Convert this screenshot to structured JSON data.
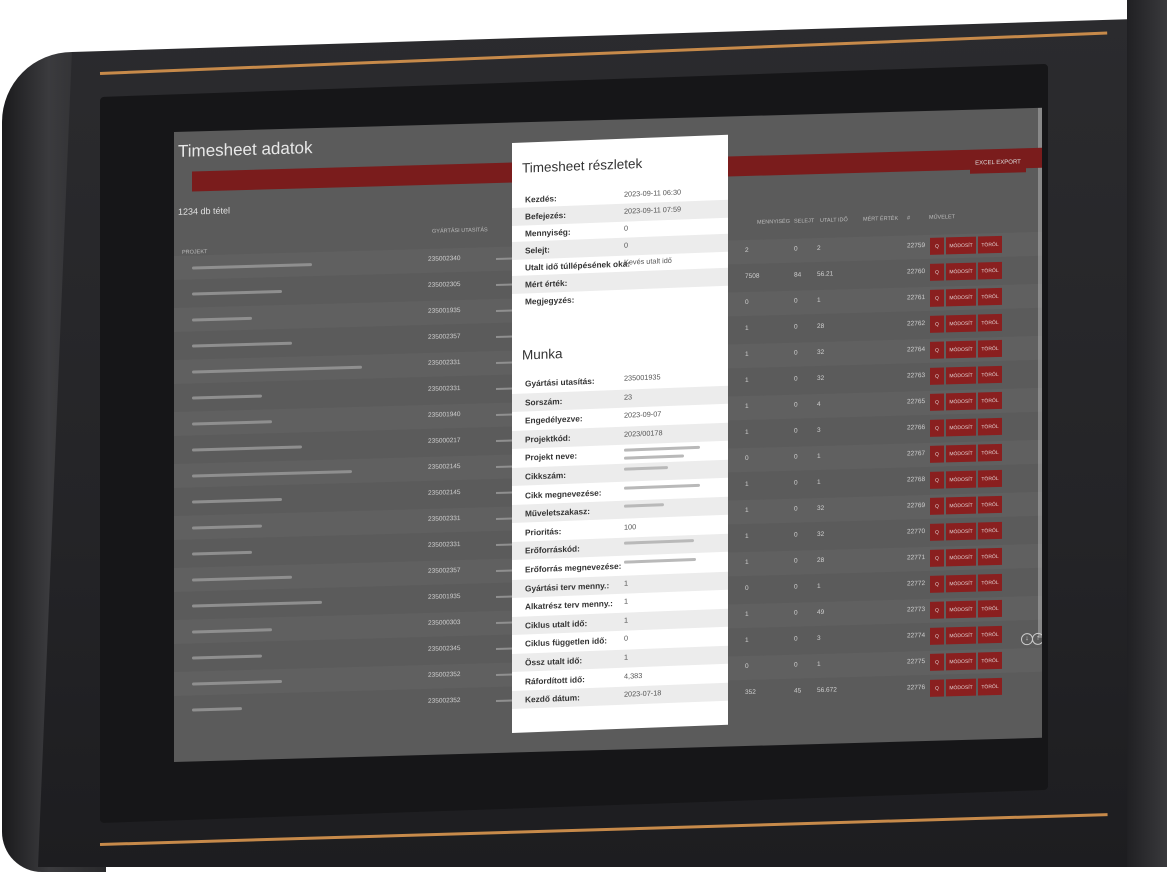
{
  "app": {
    "title": "Timesheet adatok",
    "count": "1234 db tétel",
    "export_label": "EXCEL EXPORT"
  },
  "table": {
    "headers": [
      "PROJEKT",
      "GYÁRTÁSI UTASÍTÁS",
      "MENNYISÉG",
      "SELEJT",
      "UTALT IDŐ",
      "MÉRT ÉRTÉK",
      "#",
      "MŰVELET"
    ],
    "rows": [
      {
        "order": "235002340",
        "qty": "2",
        "scrap": "0",
        "time": "2",
        "id": "22759"
      },
      {
        "order": "235002305",
        "qty": "7508",
        "scrap": "84",
        "time": "56.21",
        "id": "22760"
      },
      {
        "order": "235001935",
        "qty": "0",
        "scrap": "0",
        "time": "1",
        "id": "22761"
      },
      {
        "order": "235002357",
        "qty": "1",
        "scrap": "0",
        "time": "28",
        "id": "22762"
      },
      {
        "order": "235002331",
        "qty": "1",
        "scrap": "0",
        "time": "32",
        "id": "22764"
      },
      {
        "order": "235002331",
        "qty": "1",
        "scrap": "0",
        "time": "32",
        "id": "22763"
      },
      {
        "order": "235001940",
        "qty": "1",
        "scrap": "0",
        "time": "4",
        "id": "22765"
      },
      {
        "order": "235000217",
        "qty": "1",
        "scrap": "0",
        "time": "3",
        "id": "22766"
      },
      {
        "order": "235002145",
        "qty": "0",
        "scrap": "0",
        "time": "1",
        "id": "22767"
      },
      {
        "order": "235002145",
        "qty": "1",
        "scrap": "0",
        "time": "1",
        "id": "22768"
      },
      {
        "order": "235002331",
        "qty": "1",
        "scrap": "0",
        "time": "32",
        "id": "22769"
      },
      {
        "order": "235002331",
        "qty": "1",
        "scrap": "0",
        "time": "32",
        "id": "22770"
      },
      {
        "order": "235002357",
        "qty": "1",
        "scrap": "0",
        "time": "28",
        "id": "22771"
      },
      {
        "order": "235001935",
        "qty": "0",
        "scrap": "0",
        "time": "1",
        "id": "22772"
      },
      {
        "order": "235000303",
        "qty": "1",
        "scrap": "0",
        "time": "49",
        "id": "22773"
      },
      {
        "order": "235002345",
        "qty": "1",
        "scrap": "0",
        "time": "3",
        "id": "22774"
      },
      {
        "order": "235002352",
        "qty": "0",
        "scrap": "0",
        "time": "1",
        "id": "22775"
      },
      {
        "order": "235002352",
        "qty": "352",
        "scrap": "45",
        "time": "56.672",
        "id": "22776"
      }
    ],
    "view_label": "Q",
    "edit_label": "MÓDOSÍT",
    "delete_label": "TÖRÖL"
  },
  "modal": {
    "title": "Timesheet részletek",
    "details": [
      {
        "label": "Kezdés:",
        "value": "2023-09-11 06:30"
      },
      {
        "label": "Befejezés:",
        "value": "2023-09-11 07:59"
      },
      {
        "label": "Mennyiség:",
        "value": "0"
      },
      {
        "label": "Selejt:",
        "value": "0"
      },
      {
        "label": "Utalt idő túllépésének oka:",
        "value": "Kevés utalt idő"
      },
      {
        "label": "Mért érték:",
        "value": ""
      },
      {
        "label": "Megjegyzés:",
        "value": ""
      }
    ],
    "work_title": "Munka",
    "work": [
      {
        "label": "Gyártási utasítás:",
        "value": "235001935"
      },
      {
        "label": "Sorszám:",
        "value": "23"
      },
      {
        "label": "Engedélyezve:",
        "value": "2023-09-07"
      },
      {
        "label": "Projektkód:",
        "value": "2023/00178"
      },
      {
        "label": "Projekt neve:",
        "value": ""
      },
      {
        "label": "Cikkszám:",
        "value": ""
      },
      {
        "label": "Cikk megnevezése:",
        "value": ""
      },
      {
        "label": "Műveletszakasz:",
        "value": ""
      },
      {
        "label": "Prioritás:",
        "value": "100"
      },
      {
        "label": "Erőforráskód:",
        "value": ""
      },
      {
        "label": "Erőforrás megnevezése:",
        "value": ""
      },
      {
        "label": "Gyártási terv menny.:",
        "value": "1"
      },
      {
        "label": "Alkatrész terv menny.:",
        "value": "1"
      },
      {
        "label": "Ciklus utalt idő:",
        "value": "1"
      },
      {
        "label": "Ciklus független idő:",
        "value": "0"
      },
      {
        "label": "Össz utalt idő:",
        "value": "1"
      },
      {
        "label": "Ráfordított idő:",
        "value": "4,383"
      },
      {
        "label": "Kezdő dátum:",
        "value": "2023-07-18"
      }
    ]
  },
  "colors": {
    "accent": "#c78a4a",
    "brand_red": "#8a1f1f",
    "overlay": "#5b5b5b"
  }
}
